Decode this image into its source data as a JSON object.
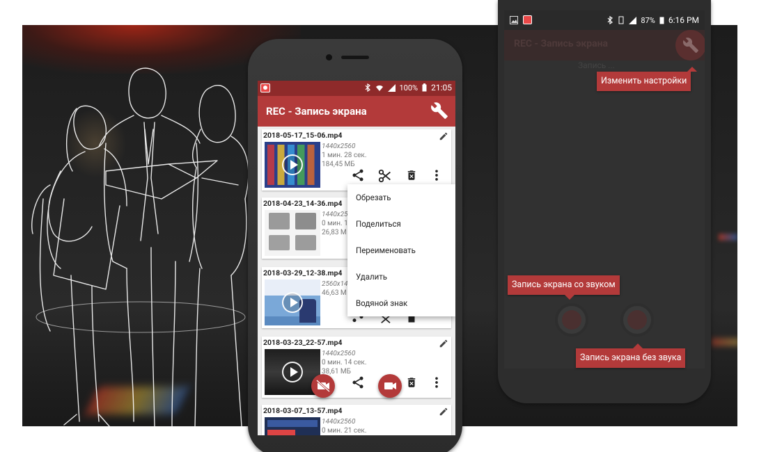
{
  "phone1": {
    "status_time": "21:05",
    "battery": "100%",
    "app_title": "REC - Запись экрана",
    "recordings": [
      {
        "filename": "2018-05-17_15-06.mp4",
        "resolution": "1440x2560",
        "duration": "1 мин. 28 сек.",
        "size": "184,45 МБ"
      },
      {
        "filename": "2018-04-23_14-36.mp4",
        "resolution": "1440x25",
        "duration": "0 мин. 1",
        "size": "26,83 М"
      },
      {
        "filename": "2018-03-29_12-38.mp4",
        "resolution": "2560x14",
        "duration": "",
        "size": "46,63 М"
      },
      {
        "filename": "2018-03-23_22-57.mp4",
        "resolution": "1440x2560",
        "duration": "0 мин. 14 сек.",
        "size": "38,61 МБ"
      },
      {
        "filename": "2018-03-07_13-57.mp4",
        "resolution": "1440x2560",
        "duration": "0 мин. 21 сек.",
        "size": ""
      }
    ],
    "context_menu": [
      "Обрезать",
      "Поделиться",
      "Переименовать",
      "Удалить",
      "Водяной знак"
    ]
  },
  "phone2": {
    "status_time": "6:16 PM",
    "battery": "87%",
    "ghost_title": "REC - Запись экрана",
    "ghost_subtitle": "Запись ...",
    "tips": {
      "settings": "Изменить настройки",
      "with_audio": "Запись экрана со звуком",
      "no_audio": "Запись экрана без звука"
    }
  },
  "colors": {
    "accent": "#b33a3a",
    "status_bar": "#8e2a2a",
    "dark_screen": "#313131"
  }
}
